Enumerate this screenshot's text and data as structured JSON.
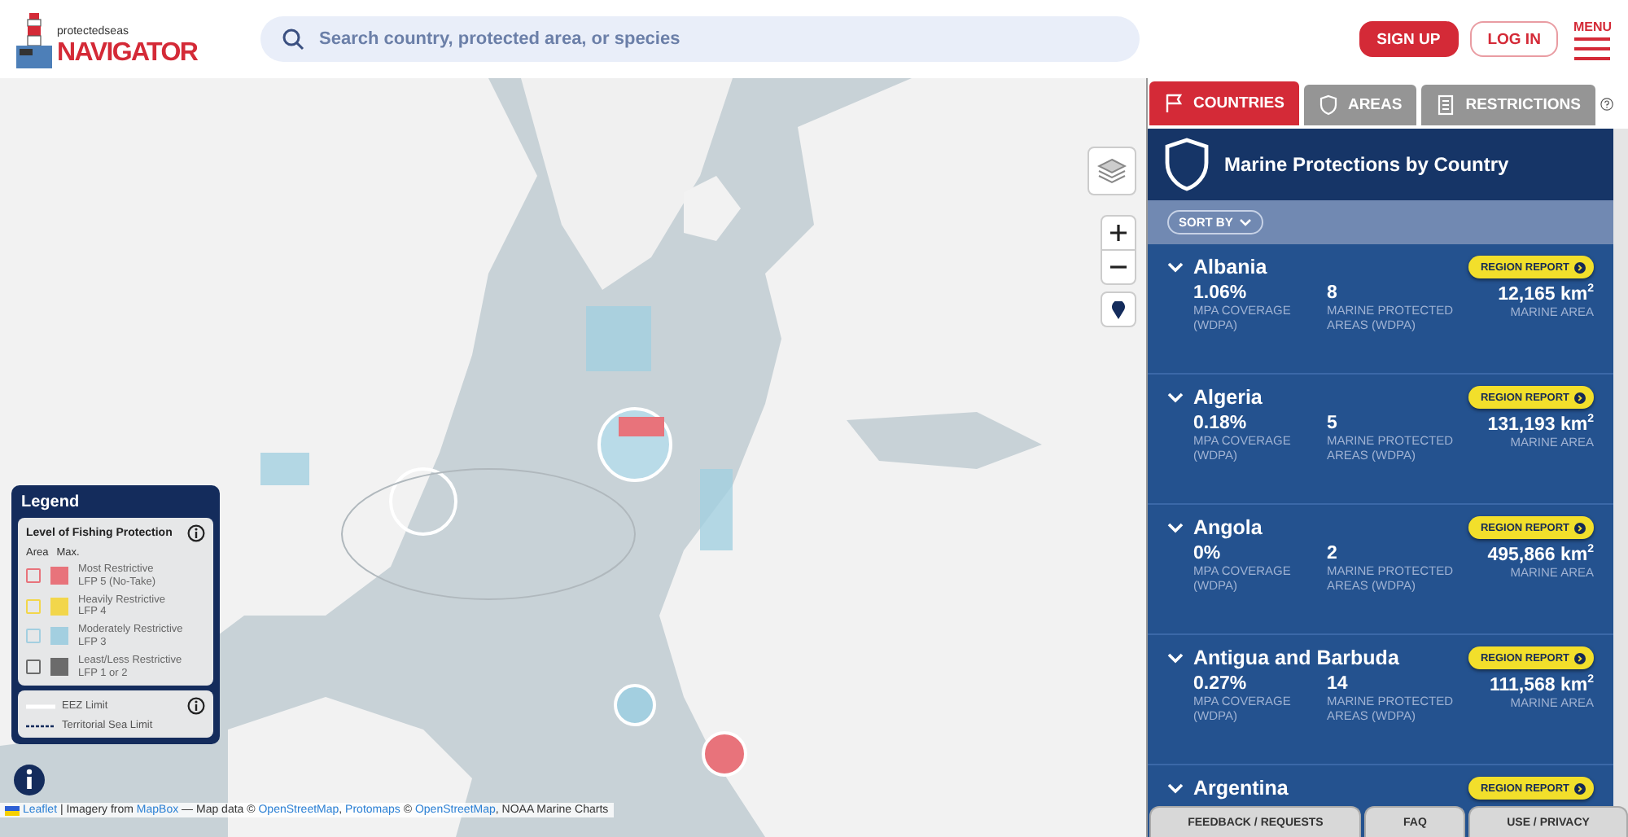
{
  "header": {
    "logo": {
      "tagline": "protectedseas",
      "name": "NAVIGATOR"
    },
    "search": {
      "placeholder": "Search country, protected area, or species"
    },
    "buttons": [
      {
        "label": "SIGN UP",
        "kind": "filled"
      },
      {
        "label": "LOG IN",
        "kind": "outline"
      }
    ],
    "menu": {
      "label": "MENU"
    }
  },
  "map": {
    "kind": "picture",
    "legend": {
      "title": "Legend",
      "section_title": "Level of Fishing Protection",
      "column_headers": [
        "Area",
        "Max."
      ],
      "levels": [
        {
          "name": "Most Restrictive",
          "code": "LFP 5 (No-Take)",
          "color": "#e8737b"
        },
        {
          "name": "Heavily Restrictive",
          "code": "LFP 4",
          "color": "#f2d64b"
        },
        {
          "name": "Moderately Restrictive",
          "code": "LFP 3",
          "color": "#a3cfe0"
        },
        {
          "name": "Least/Less Restrictive",
          "code": "LFP 1 or 2",
          "color": "#6b6b6b"
        }
      ],
      "limits": [
        {
          "label": "EEZ Limit",
          "kind": "solid"
        },
        {
          "label": "Territorial Sea Limit",
          "kind": "dashed"
        }
      ]
    },
    "attribution": [
      {
        "text": "Leaflet",
        "kind": "link"
      },
      {
        "text": " | Imagery from ",
        "kind": "text"
      },
      {
        "text": "MapBox",
        "kind": "link"
      },
      {
        "text": " — Map data © ",
        "kind": "text"
      },
      {
        "text": "OpenStreetMap",
        "kind": "link"
      },
      {
        "text": ", ",
        "kind": "text"
      },
      {
        "text": "Protomaps",
        "kind": "link"
      },
      {
        "text": " © ",
        "kind": "text"
      },
      {
        "text": "OpenStreetMap",
        "kind": "link"
      },
      {
        "text": ", NOAA Marine Charts",
        "kind": "text"
      }
    ]
  },
  "panel": {
    "tabs": [
      {
        "label": "COUNTRIES",
        "selected": true
      },
      {
        "label": "AREAS",
        "selected": false
      },
      {
        "label": "RESTRICTIONS",
        "selected": false
      }
    ],
    "title": "Marine Protections by Country",
    "sort_button": "SORT BY",
    "countries": [
      {
        "name": "Albania",
        "report_button": "REGION REPORT",
        "stats": [
          {
            "value": "1.06%",
            "label": "MPA COVERAGE (WDPA)"
          },
          {
            "value": "8",
            "label": "MARINE PROTECTED AREAS (WDPA)"
          },
          {
            "value": "12,165 km$^{2}$",
            "label": "MARINE AREA"
          }
        ]
      },
      {
        "name": "Algeria",
        "report_button": "REGION REPORT",
        "stats": [
          {
            "value": "0.18%",
            "label": "MPA COVERAGE (WDPA)"
          },
          {
            "value": "5",
            "label": "MARINE PROTECTED AREAS (WDPA)"
          },
          {
            "value": "131,193 km$^{2}$",
            "label": "MARINE AREA"
          }
        ]
      },
      {
        "name": "Angola",
        "report_button": "REGION REPORT",
        "stats": [
          {
            "value": "0%",
            "label": "MPA COVERAGE (WDPA)"
          },
          {
            "value": "2",
            "label": "MARINE PROTECTED AREAS (WDPA)"
          },
          {
            "value": "495,866 km$^{2}$",
            "label": "MARINE AREA"
          }
        ]
      },
      {
        "name": "Antigua and Barbuda",
        "report_button": "REGION REPORT",
        "stats": [
          {
            "value": "0.27%",
            "label": "MPA COVERAGE (WDPA)"
          },
          {
            "value": "14",
            "label": "MARINE PROTECTED AREAS (WDPA)"
          },
          {
            "value": "111,568 km$^{2}$",
            "label": "MARINE AREA"
          }
        ]
      },
      {
        "name": "Argentina",
        "report_button": "REGION REPORT"
      }
    ],
    "footer_tabs": [
      "FEEDBACK / REQUESTS",
      "FAQ",
      "USE / PRIVACY"
    ]
  }
}
